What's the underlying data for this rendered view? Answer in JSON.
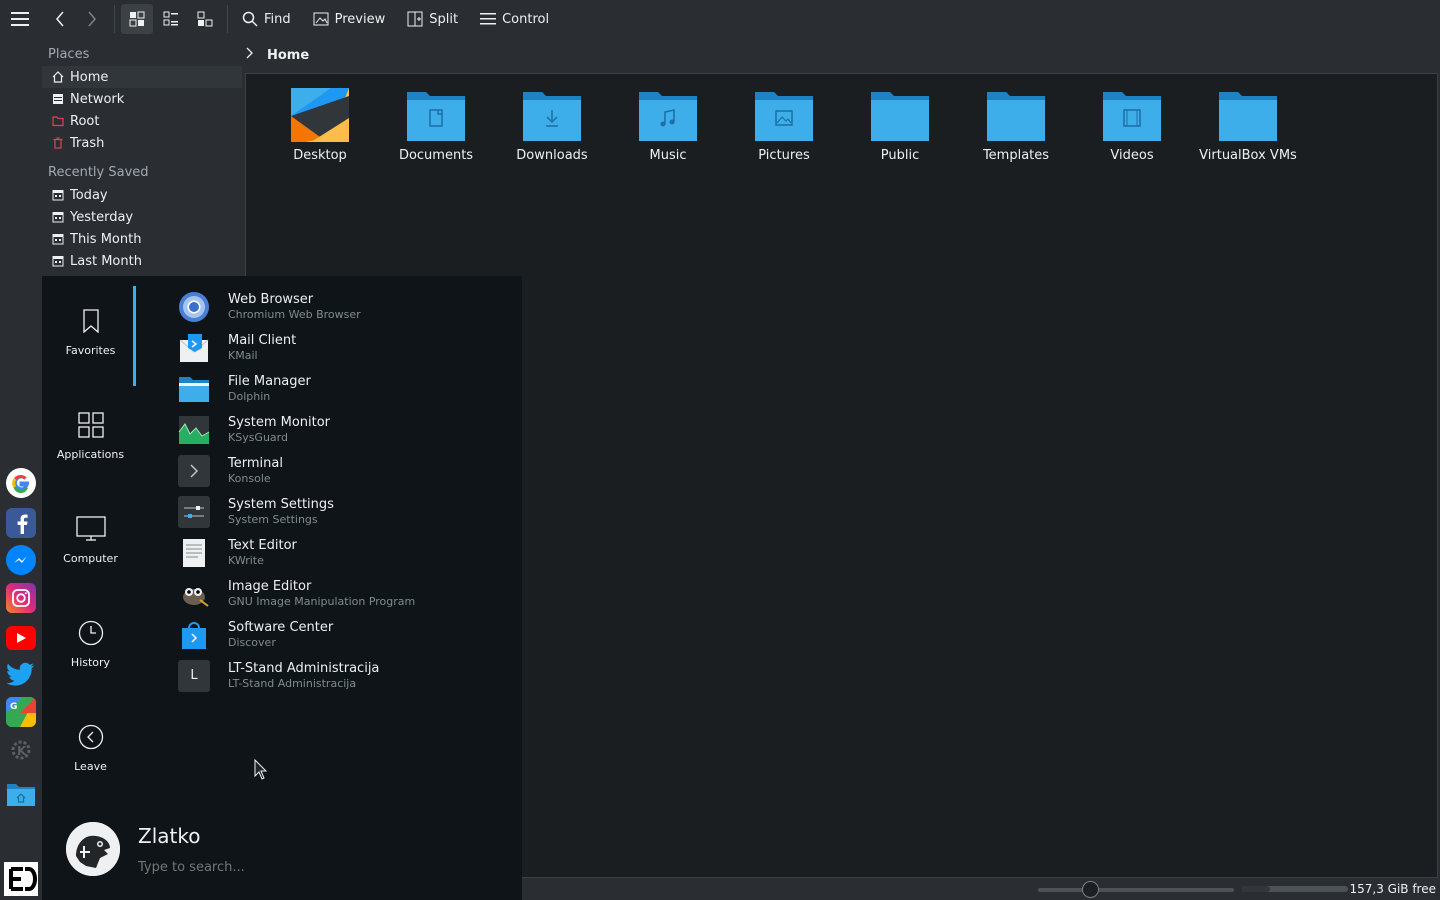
{
  "toolbar": {
    "find": "Find",
    "preview": "Preview",
    "split": "Split",
    "control": "Control"
  },
  "sidebar": {
    "places_header": "Places",
    "places": [
      "Home",
      "Network",
      "Root",
      "Trash"
    ],
    "recent_header": "Recently Saved",
    "recent": [
      "Today",
      "Yesterday",
      "This Month",
      "Last Month"
    ]
  },
  "breadcrumb": {
    "current": "Home"
  },
  "files": [
    "Desktop",
    "Documents",
    "Downloads",
    "Music",
    "Pictures",
    "Public",
    "Templates",
    "Videos",
    "VirtualBox VMs"
  ],
  "status": {
    "free": "157,3 GiB free"
  },
  "menu": {
    "categories": [
      "Favorites",
      "Applications",
      "Computer",
      "History",
      "Leave"
    ],
    "apps": [
      {
        "name": "Web Browser",
        "sub": "Chromium Web Browser"
      },
      {
        "name": "Mail Client",
        "sub": "KMail"
      },
      {
        "name": "File Manager",
        "sub": "Dolphin"
      },
      {
        "name": "System Monitor",
        "sub": "KSysGuard"
      },
      {
        "name": "Terminal",
        "sub": "Konsole"
      },
      {
        "name": "System Settings",
        "sub": "System Settings"
      },
      {
        "name": "Text Editor",
        "sub": "KWrite"
      },
      {
        "name": "Image Editor",
        "sub": "GNU Image Manipulation Program"
      },
      {
        "name": "Software Center",
        "sub": "Discover"
      },
      {
        "name": "LT-Stand Administracija",
        "sub": "LT-Stand Administracija"
      }
    ],
    "lt_icon_letter": "L",
    "user": "Zlatko",
    "search_placeholder": "Type to search..."
  },
  "colors": {
    "accent": "#3daee9",
    "folder": "#3daee9",
    "background": "#2a2e32"
  }
}
